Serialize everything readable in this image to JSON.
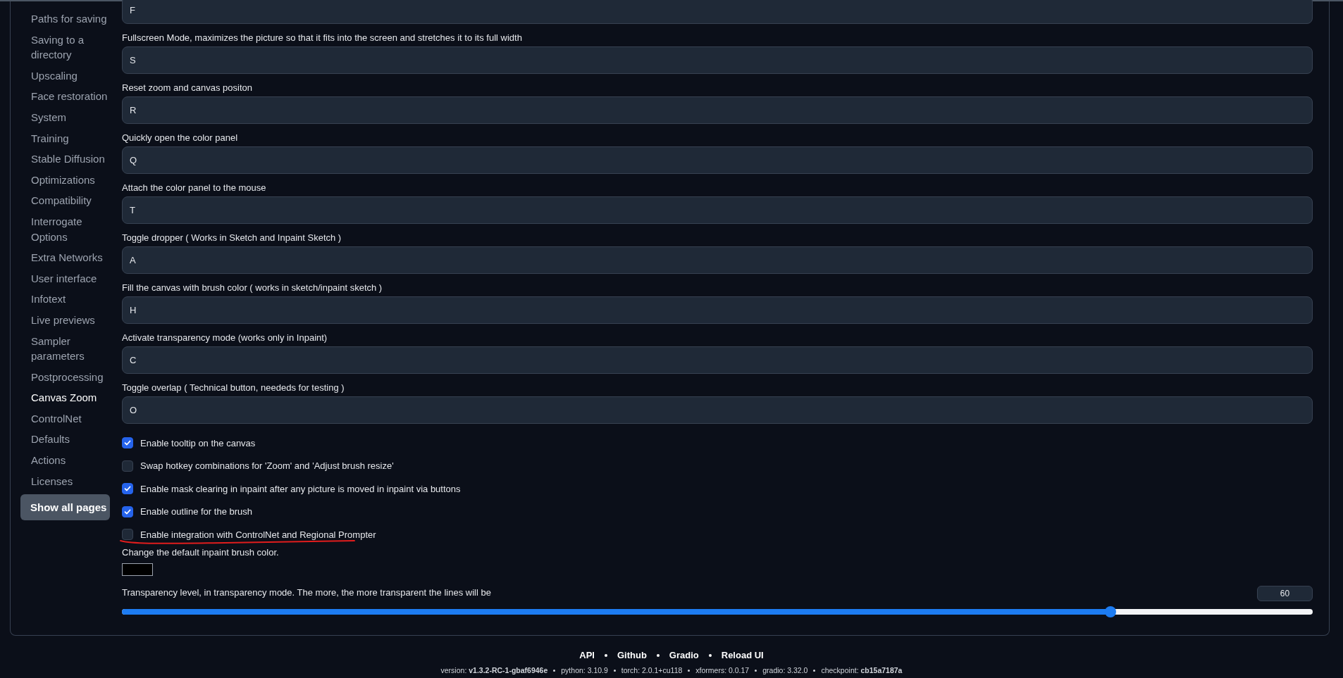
{
  "sidebar": {
    "items": [
      {
        "label": "Paths for saving",
        "selected": false
      },
      {
        "label": "Saving to a directory",
        "selected": false
      },
      {
        "label": "Upscaling",
        "selected": false
      },
      {
        "label": "Face restoration",
        "selected": false
      },
      {
        "label": "System",
        "selected": false
      },
      {
        "label": "Training",
        "selected": false
      },
      {
        "label": "Stable Diffusion",
        "selected": false
      },
      {
        "label": "Optimizations",
        "selected": false
      },
      {
        "label": "Compatibility",
        "selected": false
      },
      {
        "label": "Interrogate Options",
        "selected": false
      },
      {
        "label": "Extra Networks",
        "selected": false
      },
      {
        "label": "User interface",
        "selected": false
      },
      {
        "label": "Infotext",
        "selected": false
      },
      {
        "label": "Live previews",
        "selected": false
      },
      {
        "label": "Sampler parameters",
        "selected": false
      },
      {
        "label": "Postprocessing",
        "selected": false
      },
      {
        "label": "Canvas Zoom",
        "selected": true
      },
      {
        "label": "ControlNet",
        "selected": false
      },
      {
        "label": "Defaults",
        "selected": false
      },
      {
        "label": "Actions",
        "selected": false
      },
      {
        "label": "Licenses",
        "selected": false
      }
    ],
    "show_all_button": "Show all pages"
  },
  "hotkeys": [
    {
      "value": "F"
    },
    {
      "label": "Fullscreen Mode, maximizes the picture so that it fits into the screen and stretches it to its full width",
      "value": "S"
    },
    {
      "label": "Reset zoom and canvas positon",
      "value": "R"
    },
    {
      "label": "Quickly open the color panel",
      "value": "Q"
    },
    {
      "label": "Attach the color panel to the mouse",
      "value": "T"
    },
    {
      "label": "Toggle dropper ( Works in Sketch and Inpaint Sketch )",
      "value": "A"
    },
    {
      "label": "Fill the canvas with brush color ( works in sketch/inpaint sketch )",
      "value": "H"
    },
    {
      "label": "Activate transparency mode (works only in Inpaint)",
      "value": "C"
    },
    {
      "label": "Toggle overlap ( Technical button, neededs for testing )",
      "value": "O"
    }
  ],
  "checkboxes": [
    {
      "label": "Enable tooltip on the canvas",
      "checked": true,
      "underlined": false
    },
    {
      "label": "Swap hotkey combinations for 'Zoom' and 'Adjust brush resize'",
      "checked": false,
      "underlined": false
    },
    {
      "label": "Enable mask clearing in inpaint after any picture is moved in inpaint via buttons",
      "checked": true,
      "underlined": false
    },
    {
      "label": "Enable outline for the brush",
      "checked": true,
      "underlined": false
    },
    {
      "label": "Enable integration with ControlNet and Regional Prompter",
      "checked": false,
      "underlined": true
    }
  ],
  "color_setting": {
    "label": "Change the default inpaint brush color.",
    "color": "#000000"
  },
  "slider": {
    "label": "Transparency level, in transparency mode. The more, the more transparent the lines will be",
    "value": "60",
    "level": 0.83
  },
  "footer": {
    "links": [
      "API",
      "Github",
      "Gradio",
      "Reload UI"
    ],
    "versions": [
      "version: **v1.3.2-RC-1-gbaf6946e**",
      "python: 3.10.9",
      "torch: 2.0.1+cu118",
      "xformers: 0.0.17",
      "gradio: 3.32.0",
      "checkpoint: **cb15a7187a**"
    ]
  }
}
